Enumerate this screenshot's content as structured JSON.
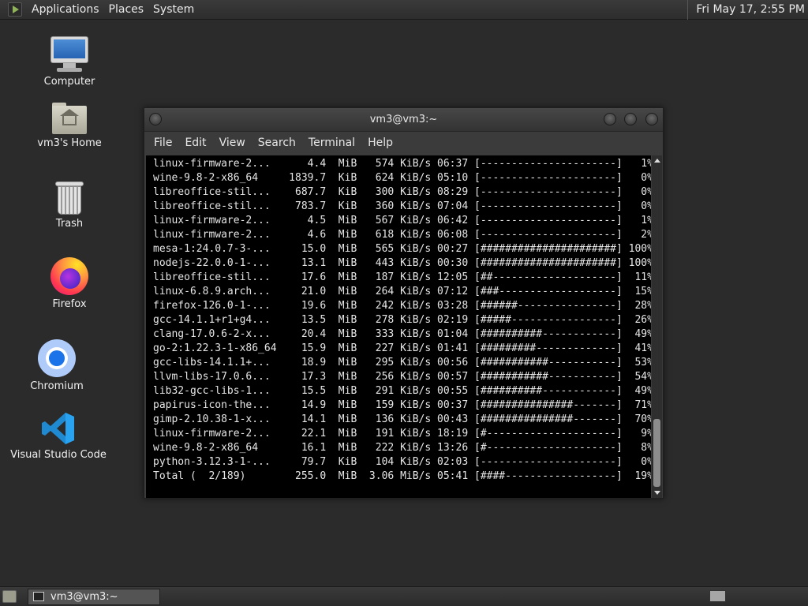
{
  "top_panel": {
    "menus": [
      "Applications",
      "Places",
      "System"
    ],
    "clock": "Fri May 17,  2:55 PM"
  },
  "desktop_icons": [
    {
      "label": "Computer",
      "icon": "computer-icon"
    },
    {
      "label": "vm3's Home",
      "icon": "home-folder-icon"
    },
    {
      "label": "Trash",
      "icon": "trash-icon"
    },
    {
      "label": "Firefox",
      "icon": "firefox-icon"
    },
    {
      "label": "Chromium",
      "icon": "chromium-icon"
    },
    {
      "label": "Visual Studio Code",
      "icon": "vscode-icon"
    }
  ],
  "terminal": {
    "title": "vm3@vm3:~",
    "menus": [
      "File",
      "Edit",
      "View",
      "Search",
      "Terminal",
      "Help"
    ],
    "lines": [
      "linux-firmware-2...      4.4  MiB   574 KiB/s 06:37 [----------------------]   1%",
      "wine-9.8-2-x86_64     1839.7  KiB   624 KiB/s 05:10 [----------------------]   0%",
      "libreoffice-stil...    687.7  KiB   300 KiB/s 08:29 [----------------------]   0%",
      "libreoffice-stil...    783.7  KiB   360 KiB/s 07:04 [----------------------]   0%",
      "linux-firmware-2...      4.5  MiB   567 KiB/s 06:42 [----------------------]   1%",
      "linux-firmware-2...      4.6  MiB   618 KiB/s 06:08 [----------------------]   2%",
      "mesa-1:24.0.7-3-...     15.0  MiB   565 KiB/s 00:27 [######################] 100%",
      "nodejs-22.0.0-1-...     13.1  MiB   443 KiB/s 00:30 [######################] 100%",
      "libreoffice-stil...     17.6  MiB   187 KiB/s 12:05 [##--------------------]  11%",
      "linux-6.8.9.arch...     21.0  MiB   264 KiB/s 07:12 [###-------------------]  15%",
      "firefox-126.0-1-...     19.6  MiB   242 KiB/s 03:28 [######----------------]  28%",
      "gcc-14.1.1+r1+g4...     13.5  MiB   278 KiB/s 02:19 [#####-----------------]  26%",
      "clang-17.0.6-2-x...     20.4  MiB   333 KiB/s 01:04 [##########------------]  49%",
      "go-2:1.22.3-1-x86_64    15.9  MiB   227 KiB/s 01:41 [#########-------------]  41%",
      "gcc-libs-14.1.1+...     18.9  MiB   295 KiB/s 00:56 [###########-----------]  53%",
      "llvm-libs-17.0.6...     17.3  MiB   256 KiB/s 00:57 [###########-----------]  54%",
      "lib32-gcc-libs-1...     15.5  MiB   291 KiB/s 00:55 [##########------------]  49%",
      "papirus-icon-the...     14.9  MiB   159 KiB/s 00:37 [###############-------]  71%",
      "gimp-2.10.38-1-x...     14.1  MiB   136 KiB/s 00:43 [###############-------]  70%",
      "linux-firmware-2...     22.1  MiB   191 KiB/s 18:19 [#---------------------]   9%",
      "wine-9.8-2-x86_64       16.1  MiB   222 KiB/s 13:26 [#---------------------]   8%",
      "python-3.12.3-1-...     79.7  KiB   104 KiB/s 02:03 [----------------------]   0%",
      "Total (  2/189)        255.0  MiB  3.06 MiB/s 05:41 [####------------------]  19%"
    ]
  },
  "taskbar": {
    "task_label": "vm3@vm3:~"
  }
}
